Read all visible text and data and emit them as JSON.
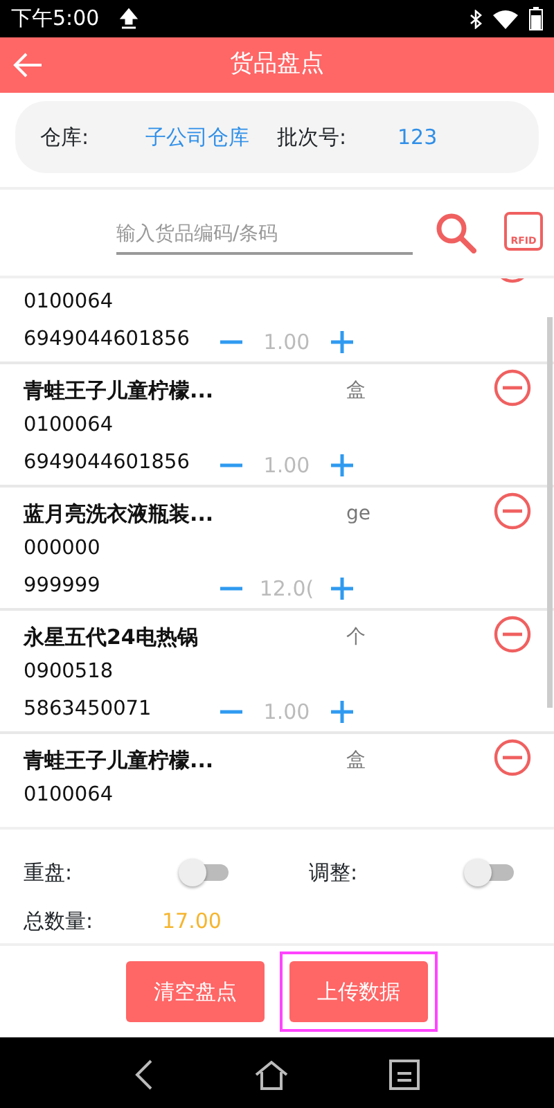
{
  "status_bar": {
    "time": "下午5:00"
  },
  "header": {
    "title": "货品盘点"
  },
  "info": {
    "warehouse_label": "仓库:",
    "warehouse": "子公司仓库",
    "batch_label": "批次号:",
    "batch": "123"
  },
  "search": {
    "placeholder": "输入货品编码/条码",
    "rfid_label": "RFID"
  },
  "items": [
    {
      "code": "0100064",
      "barcode": "6949044601856",
      "quantity": "1.00"
    },
    {
      "name": "青蛙王子儿童柠檬...",
      "unit": "盒",
      "code": "0100064",
      "barcode": "6949044601856",
      "quantity": "1.00"
    },
    {
      "name": "蓝月亮洗衣液瓶装...",
      "unit": "ge",
      "code": "000000",
      "barcode": "999999",
      "quantity": "12.0("
    },
    {
      "name": "永星五代24电热锅",
      "unit": "个",
      "code": "0900518",
      "barcode": "5863450071",
      "quantity": "1.00"
    },
    {
      "name": "青蛙王子儿童柠檬...",
      "unit": "盒",
      "code": "0100064"
    }
  ],
  "options": [
    {
      "label": "重盘:",
      "on": false
    },
    {
      "label": "调整:",
      "on": false
    }
  ],
  "total": {
    "label": "总数量:",
    "value": "17.00"
  },
  "buttons": [
    {
      "label": "清空盘点",
      "highlighted": false
    },
    {
      "label": "上传数据",
      "highlighted": true
    }
  ]
}
